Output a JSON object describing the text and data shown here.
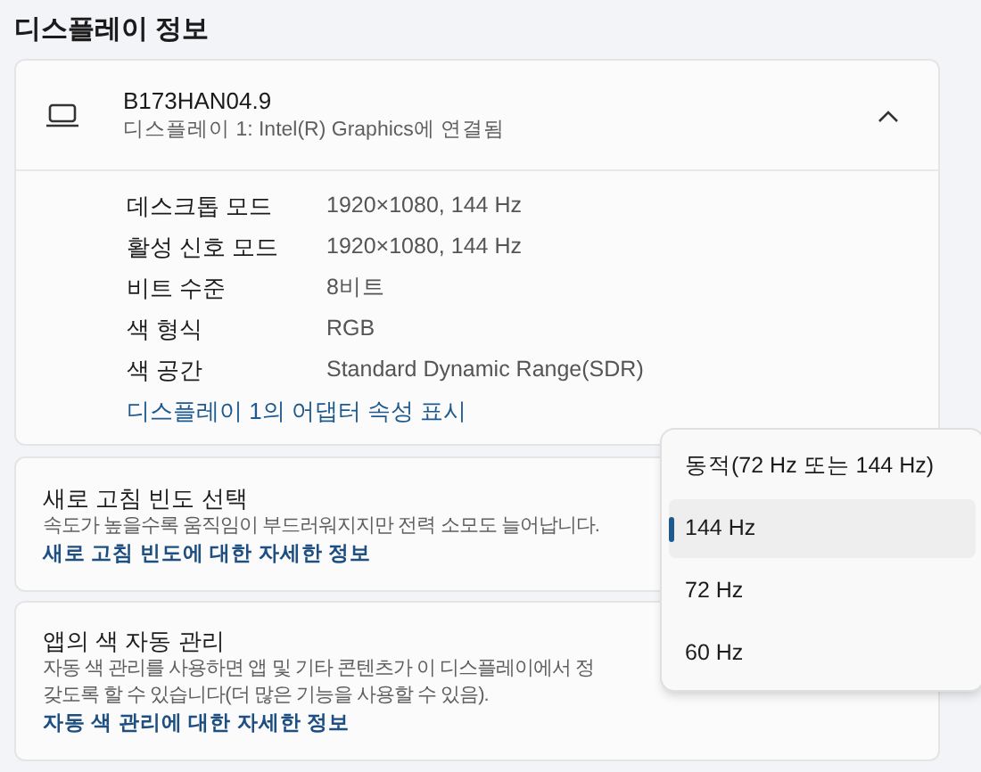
{
  "section_title": "디스플레이 정보",
  "display": {
    "name": "B173HAN04.9",
    "subtitle": "디스플레이 1: Intel(R) Graphics에 연결됨",
    "expanded": true,
    "properties": [
      {
        "label": "데스크톱 모드",
        "value": "1920×1080, 144 Hz"
      },
      {
        "label": "활성 신호 모드",
        "value": "1920×1080, 144 Hz"
      },
      {
        "label": "비트 수준",
        "value": "8비트"
      },
      {
        "label": "색 형식",
        "value": "RGB"
      },
      {
        "label": "색 공간",
        "value": "Standard Dynamic Range(SDR)"
      }
    ],
    "link": "디스플레이 1의 어댑터 속성 표시"
  },
  "refresh_rate": {
    "title": "새로 고침 빈도 선택",
    "description": "속도가 높을수록 움직임이 부드러워지지만 전력 소모도 늘어납니다.",
    "link": "새로 고침 빈도에 대한 자세한 정보"
  },
  "auto_color": {
    "title": "앱의 색 자동 관리",
    "description_lines": [
      "자동 색 관리를 사용하면 앱 및 기타 콘텐츠가 이 디스플레이에서 정",
      "갖도록 할 수 있습니다(더 많은 기능을 사용할 수 있음)."
    ],
    "link": "자동 색 관리에 대한 자세한 정보"
  },
  "refresh_menu": [
    {
      "label": "동적(72 Hz 또는 144 Hz)",
      "selected": false
    },
    {
      "label": "144 Hz",
      "selected": true
    },
    {
      "label": "72 Hz",
      "selected": false
    },
    {
      "label": "60 Hz",
      "selected": false
    }
  ]
}
